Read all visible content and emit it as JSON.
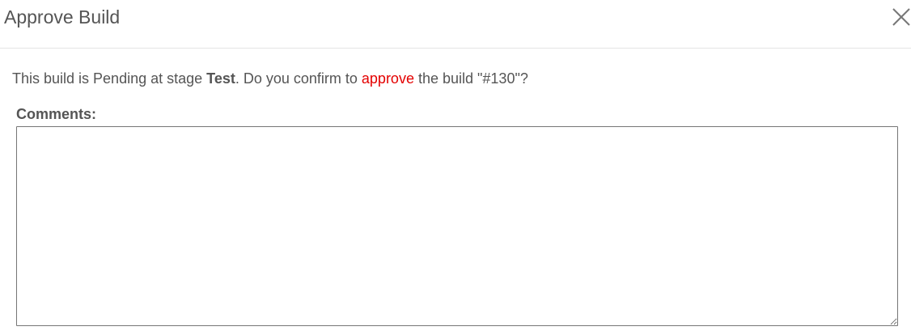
{
  "dialog": {
    "title": "Approve Build",
    "close_icon": "close-icon",
    "message": {
      "prefix": "This build is Pending at stage ",
      "stage": "Test",
      "middle": ". Do you confirm to ",
      "action": "approve",
      "suffix": " the build \"#130\"?"
    },
    "comments": {
      "label": "Comments:",
      "value": "",
      "placeholder": ""
    }
  },
  "colors": {
    "text": "#555555",
    "action_highlight": "#e40000",
    "divider": "#e5e5e5",
    "border": "#767676"
  }
}
